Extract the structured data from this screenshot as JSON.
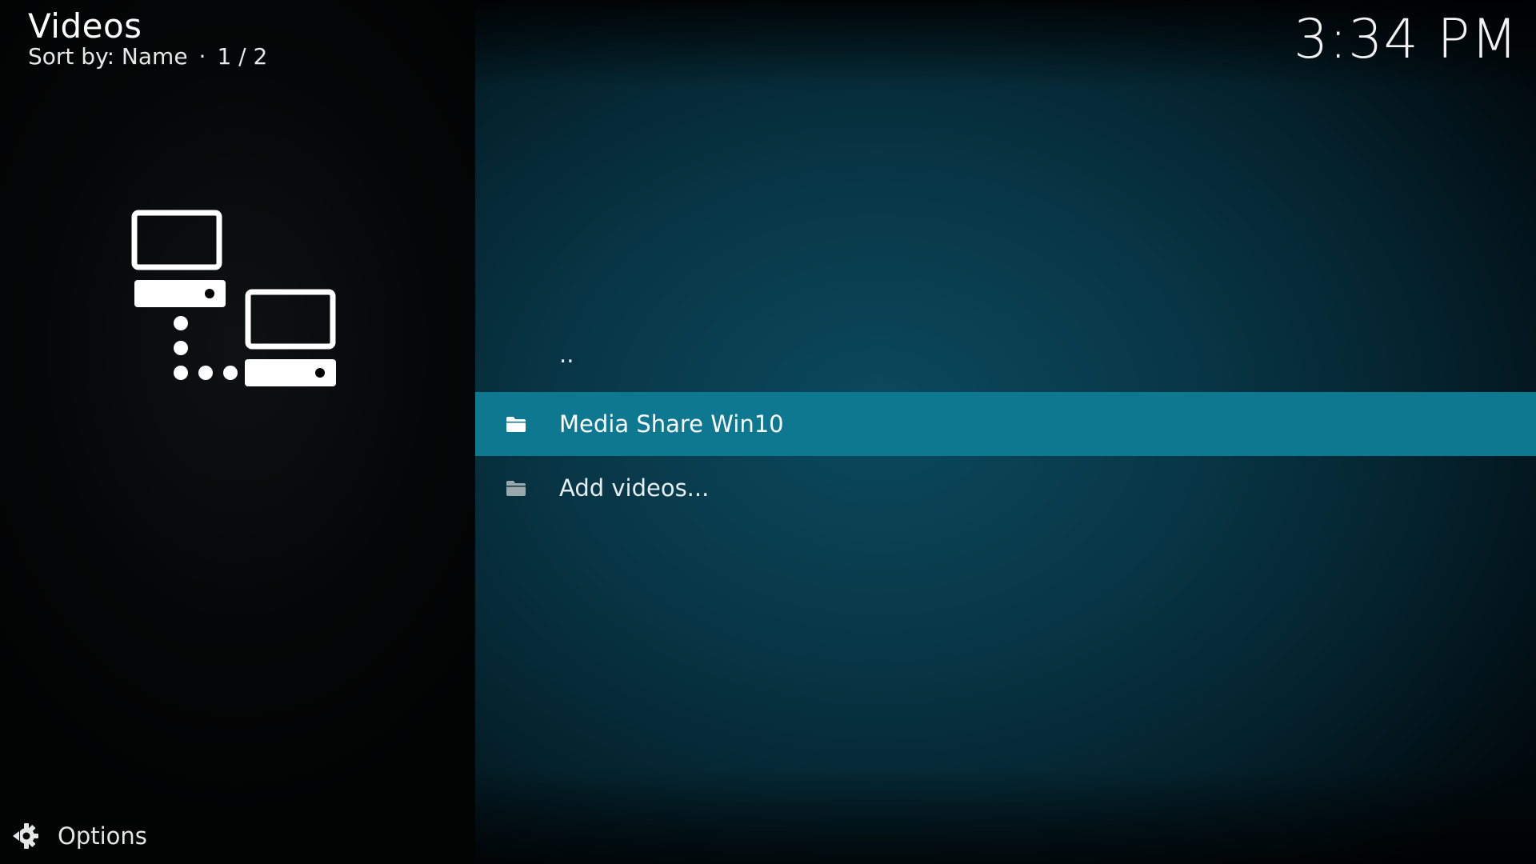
{
  "header": {
    "title": "Videos",
    "sort_text": "Sort by: Name",
    "separator": "·",
    "page_indicator": "1 / 2"
  },
  "clock": {
    "time": "3:34 PM"
  },
  "list": {
    "items": [
      {
        "label": "..",
        "icon": "none",
        "selected": false
      },
      {
        "label": "Media Share Win10",
        "icon": "folder-icon",
        "selected": true
      },
      {
        "label": "Add videos...",
        "icon": "folder-icon",
        "selected": false
      }
    ]
  },
  "sidebar_art": {
    "icon": "network-icon"
  },
  "options": {
    "label": "Options",
    "icon": "gear-icon"
  },
  "colors": {
    "selection": "#0f7891",
    "background_teal": "#0b4a5e",
    "text": "#ffffff"
  }
}
